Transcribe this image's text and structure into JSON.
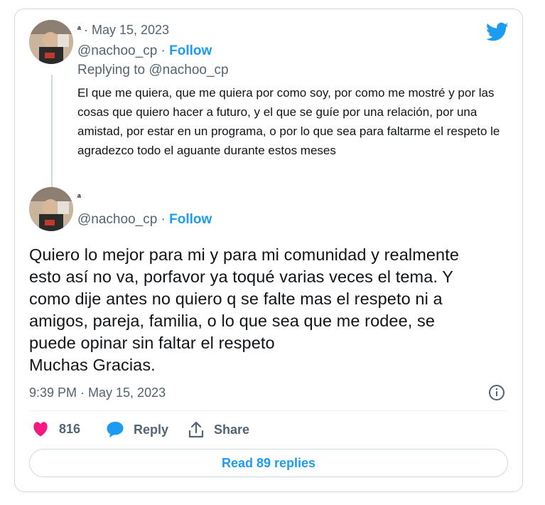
{
  "reply_tweet": {
    "display_name": "ᵃ",
    "date": "· May 15, 2023",
    "handle": "@nachoo_cp",
    "separator": "·",
    "follow_label": "Follow",
    "replying_to_label": "Replying to",
    "replying_to_handle": "@nachoo_cp",
    "text": "El que me quiera, que me quiera por como soy, por como me mostré y por las cosas que quiero hacer a futuro, y el que se guíe por una relación, por una amistad, por estar en un programa, o por lo que sea para faltarme el respeto le agradezco todo el aguante durante estos meses"
  },
  "main_tweet": {
    "display_name": "ᵃ",
    "handle": "@nachoo_cp",
    "separator": "·",
    "follow_label": "Follow",
    "text_lines": [
      "Quiero lo mejor para mi y para mi comunidad y realmente",
      "esto así no va, porfavor ya toqué varias veces el tema. Y",
      "como dije antes no quiero q se falte mas el respeto ni a",
      "amigos, pareja, familia, o lo que sea que me rodee, se",
      "puede opinar sin faltar el respeto",
      "Muchas Gracias."
    ],
    "timestamp": "9:39 PM · May 15, 2023"
  },
  "actions": {
    "like_count": "816",
    "reply_label": "Reply",
    "share_label": "Share"
  },
  "read_replies_label": "Read 89 replies",
  "colors": {
    "accent": "#1d9bf0",
    "like": "#f91880",
    "text": "#0f1419",
    "muted": "#536471",
    "border": "#cfd9de"
  },
  "icons": [
    "twitter-bird-icon",
    "info-icon",
    "heart-icon",
    "reply-bubble-icon",
    "share-icon"
  ]
}
